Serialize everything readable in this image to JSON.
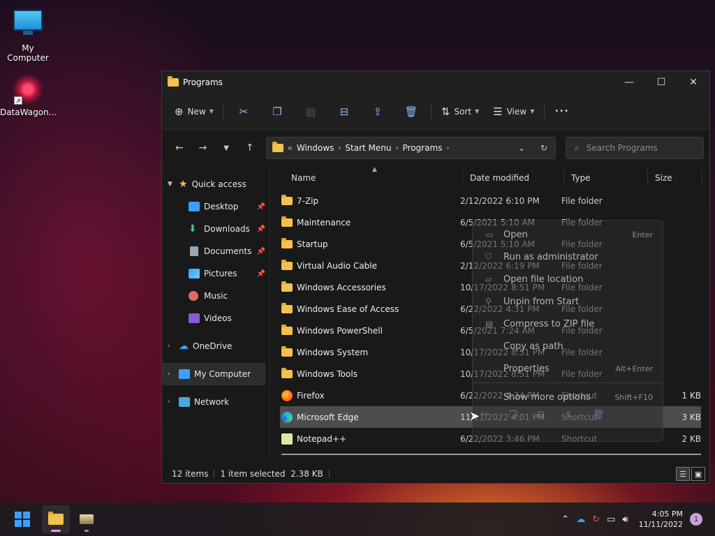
{
  "desktop": {
    "icons": [
      {
        "label": "My Computer",
        "icon": "monitor-icon"
      },
      {
        "label": "DataWagon...",
        "icon": "datawagon-icon"
      }
    ]
  },
  "window": {
    "title": "Programs",
    "controls": {
      "minimize": "—",
      "maximize": "☐",
      "close": "✕"
    }
  },
  "toolbar": {
    "new_label": "New",
    "sort_label": "Sort",
    "view_label": "View",
    "more": "•••"
  },
  "address": {
    "overflow": "«",
    "crumbs": [
      "Windows",
      "Start Menu",
      "Programs"
    ],
    "search_placeholder": "Search Programs"
  },
  "sidebar": {
    "quick_access": "Quick access",
    "pinned": [
      "Desktop",
      "Downloads",
      "Documents",
      "Pictures"
    ],
    "others": [
      "Music",
      "Videos"
    ],
    "onedrive": "OneDrive",
    "my_computer": "My Computer",
    "network": "Network"
  },
  "columns": {
    "name": "Name",
    "date": "Date modified",
    "type": "Type",
    "size": "Size"
  },
  "files": [
    {
      "name": "7-Zip",
      "date": "2/12/2022 6:10 PM",
      "type": "File folder",
      "size": "",
      "kind": "folder"
    },
    {
      "name": "Maintenance",
      "date": "6/5/2021 5:10 AM",
      "type": "File folder",
      "size": "",
      "kind": "folder"
    },
    {
      "name": "Startup",
      "date": "6/5/2021 5:10 AM",
      "type": "File folder",
      "size": "",
      "kind": "folder"
    },
    {
      "name": "Virtual Audio Cable",
      "date": "2/12/2022 6:19 PM",
      "type": "File folder",
      "size": "",
      "kind": "folder"
    },
    {
      "name": "Windows Accessories",
      "date": "10/17/2022 8:51 PM",
      "type": "File folder",
      "size": "",
      "kind": "folder"
    },
    {
      "name": "Windows Ease of Access",
      "date": "6/22/2022 4:31 PM",
      "type": "File folder",
      "size": "",
      "kind": "folder"
    },
    {
      "name": "Windows PowerShell",
      "date": "6/5/2021 7:24 AM",
      "type": "File folder",
      "size": "",
      "kind": "folder"
    },
    {
      "name": "Windows System",
      "date": "10/17/2022 8:51 PM",
      "type": "File folder",
      "size": "",
      "kind": "folder"
    },
    {
      "name": "Windows Tools",
      "date": "10/17/2022 8:51 PM",
      "type": "File folder",
      "size": "",
      "kind": "folder"
    },
    {
      "name": "Firefox",
      "date": "6/22/2022 4:34 PM",
      "type": "Shortcut",
      "size": "1 KB",
      "kind": "firefox"
    },
    {
      "name": "Microsoft Edge",
      "date": "11/11/2022 4:01 PM",
      "type": "Shortcut",
      "size": "3 KB",
      "kind": "edge"
    },
    {
      "name": "Notepad++",
      "date": "6/22/2022 3:46 PM",
      "type": "Shortcut",
      "size": "2 KB",
      "kind": "notepad"
    }
  ],
  "context_menu": {
    "items": [
      {
        "label": "Open",
        "shortcut": "Enter"
      },
      {
        "label": "Run as administrator",
        "shortcut": ""
      },
      {
        "label": "Open file location",
        "shortcut": ""
      },
      {
        "label": "Unpin from Start",
        "shortcut": ""
      },
      {
        "label": "Compress to ZIP file",
        "shortcut": ""
      },
      {
        "label": "Copy as path",
        "shortcut": ""
      },
      {
        "label": "Properties",
        "shortcut": "Alt+Enter"
      }
    ],
    "more": {
      "label": "Show more options",
      "shortcut": "Shift+F10"
    }
  },
  "status": {
    "count": "12 items",
    "selected": "1 item selected",
    "size": "2.38 KB"
  },
  "taskbar": {
    "time": "4:05 PM",
    "date": "11/11/2022",
    "notifications": "1"
  },
  "colors": {
    "accent": "#3aa0ff",
    "folder": "#f2c14e",
    "selected_row": "#4d4d4d"
  }
}
